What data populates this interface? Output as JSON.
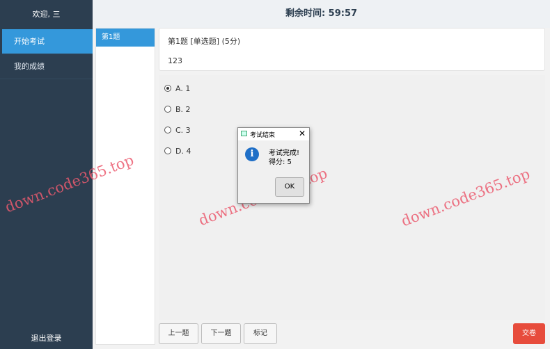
{
  "sidebar": {
    "welcome": "欢迎, 三",
    "items": [
      {
        "label": "开始考试",
        "active": true
      },
      {
        "label": "我的成绩",
        "active": false
      }
    ],
    "logout": "退出登录"
  },
  "header": {
    "timer": "剩余时间: 59:57"
  },
  "question_nav": {
    "items": [
      "第1题"
    ]
  },
  "question": {
    "title": "第1题 [单选题] (5分)",
    "content": "123",
    "options": [
      {
        "label": "A. 1",
        "checked": true
      },
      {
        "label": "B. 2",
        "checked": false
      },
      {
        "label": "C. 3",
        "checked": false
      },
      {
        "label": "D. 4",
        "checked": false
      }
    ]
  },
  "footer": {
    "prev": "上一题",
    "next": "下一题",
    "mark": "标记",
    "submit": "交卷"
  },
  "dialog": {
    "title": "考试结束",
    "close": "✕",
    "info_glyph": "i",
    "message_line1": "考试完成!",
    "message_line2": "得分: 5",
    "ok": "OK"
  },
  "watermarks": [
    "down.code365.top",
    "down.code365.top",
    "down.code365.top"
  ],
  "colors": {
    "sidebar_bg": "#2c3e50",
    "accent": "#3498db",
    "submit": "#e74c3c",
    "watermark": "#eb5a6e"
  }
}
